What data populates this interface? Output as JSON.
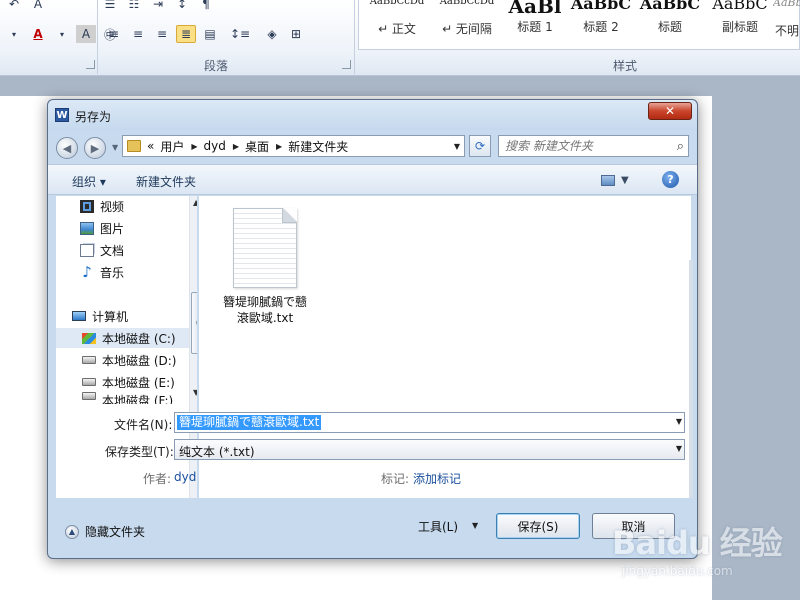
{
  "ribbon": {
    "group_paragraph": "段落",
    "group_styles": "样式",
    "styles": [
      {
        "sample": "AaBbCcDd",
        "name": "↵ 正文"
      },
      {
        "sample": "AaBbCcDd",
        "name": "↵ 无间隔"
      },
      {
        "sample": "AaBl",
        "name": "标题 1"
      },
      {
        "sample": "AaBbC",
        "name": "标题 2"
      },
      {
        "sample": "AaBbC",
        "name": "标题"
      },
      {
        "sample": "AaBbC",
        "name": "副标题"
      },
      {
        "sample": "AaBb",
        "name": "不明"
      }
    ]
  },
  "dialog": {
    "title": "另存为",
    "app_icon_letter": "W",
    "close_glyph": "✕",
    "address": {
      "overflow": "«",
      "crumbs": [
        "用户",
        "dyd",
        "桌面",
        "新建文件夹"
      ]
    },
    "search_placeholder": "搜索 新建文件夹",
    "toolbar": {
      "organize": "组织 ▾",
      "new_folder": "新建文件夹",
      "help_glyph": "?"
    },
    "nav": {
      "items": [
        {
          "label": "视频",
          "icon": "video-icon"
        },
        {
          "label": "图片",
          "icon": "picture-icon"
        },
        {
          "label": "文档",
          "icon": "document-icon"
        },
        {
          "label": "音乐",
          "icon": "music-icon"
        },
        {
          "label": "计算机",
          "icon": "computer-icon"
        },
        {
          "label": "本地磁盘 (C:)",
          "icon": "windows-drive-icon"
        },
        {
          "label": "本地磁盘 (D:)",
          "icon": "drive-icon"
        },
        {
          "label": "本地磁盘 (E:)",
          "icon": "drive-icon"
        },
        {
          "label": "本地磁盘 (F:)",
          "icon": "drive-icon"
        }
      ]
    },
    "file": {
      "name_line1": "簪堤珋膩鍋で戆",
      "name_line2": "滖歐域.txt"
    },
    "form": {
      "filename_label": "文件名(N):",
      "filename_value": "簪堤珋膩鍋で戆滖歐域.txt",
      "type_label": "保存类型(T):",
      "type_value": "纯文本 (*.txt)",
      "author_label": "作者:",
      "author_value": "dyd",
      "tags_label": "标记:",
      "tags_value": "添加标记"
    },
    "bottom": {
      "hide_folders": "隐藏文件夹",
      "tools": "工具(L)",
      "save": "保存(S)",
      "cancel": "取消"
    }
  },
  "watermark": {
    "logo": "Baidu 经验",
    "url": "jingyan.baidu.com"
  }
}
